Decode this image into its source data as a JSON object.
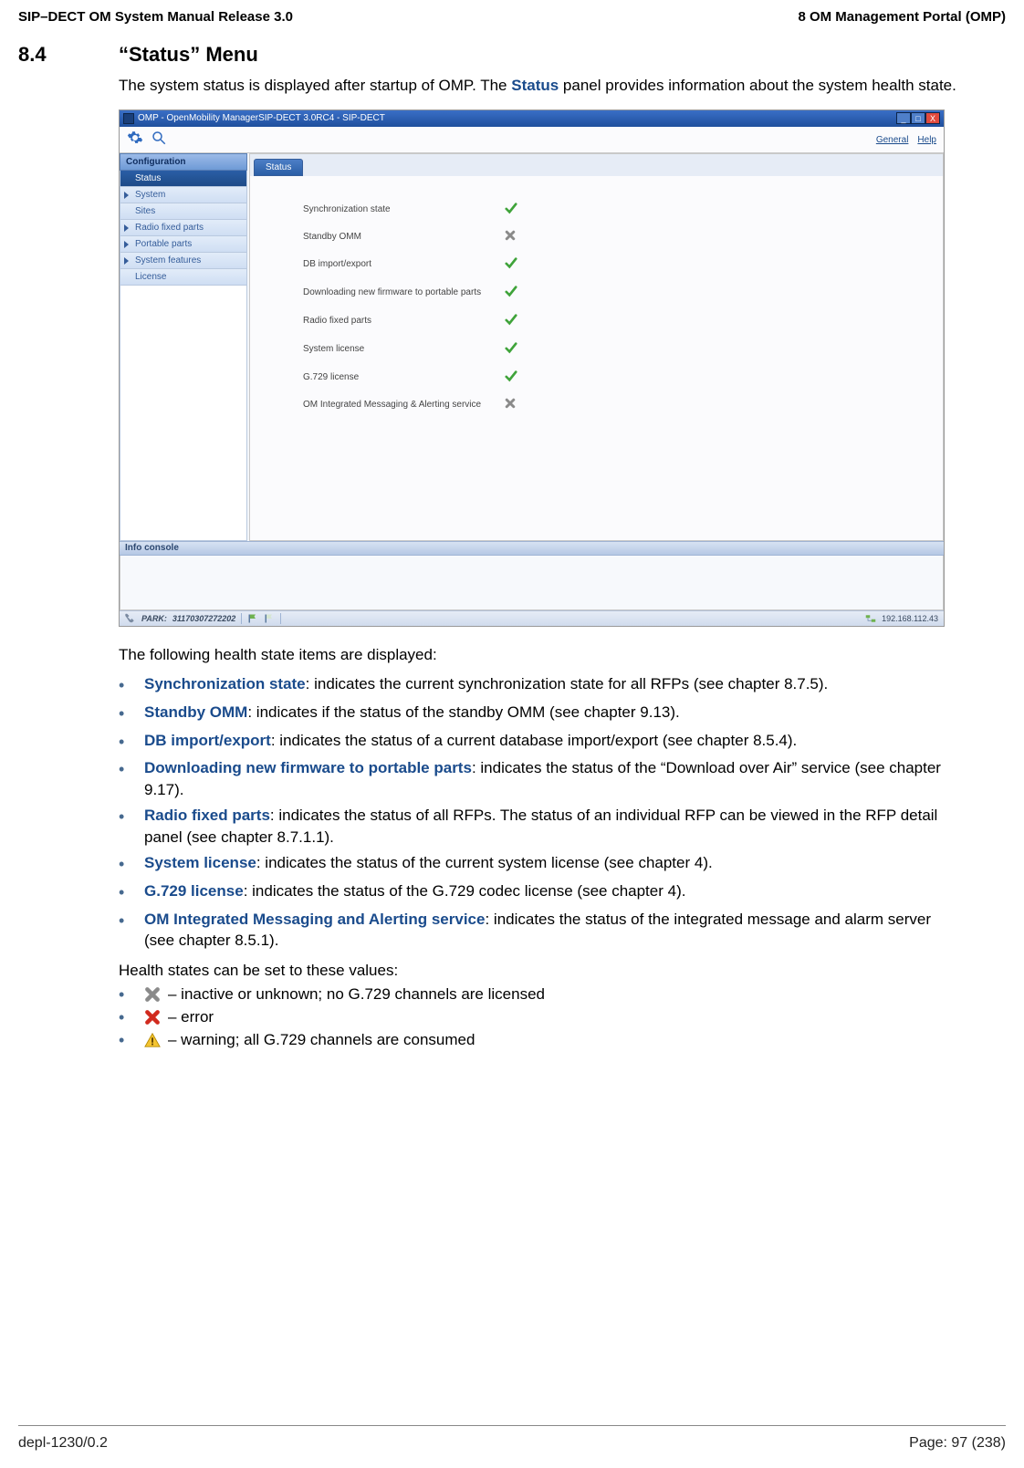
{
  "header": {
    "left": "SIP–DECT OM System Manual Release 3.0",
    "right": "8 OM Management Portal (OMP)"
  },
  "section": {
    "num": "8.4",
    "title": "“Status” Menu"
  },
  "intro": {
    "pre": "The system status is displayed after startup of OMP. The ",
    "bold": "Status",
    "post": " panel provides information about the system health state."
  },
  "app": {
    "title": "OMP - OpenMobility ManagerSIP-DECT 3.0RC4 - SIP-DECT",
    "nav": {
      "general": "General",
      "help": "Help"
    },
    "side_head": "Configuration",
    "sidebar": [
      {
        "label": "Status",
        "selected": true,
        "arrow": false
      },
      {
        "label": "System",
        "selected": false,
        "arrow": true
      },
      {
        "label": "Sites",
        "selected": false,
        "arrow": false
      },
      {
        "label": "Radio fixed parts",
        "selected": false,
        "arrow": true
      },
      {
        "label": "Portable parts",
        "selected": false,
        "arrow": true
      },
      {
        "label": "System features",
        "selected": false,
        "arrow": true
      },
      {
        "label": "License",
        "selected": false,
        "arrow": false
      }
    ],
    "tab": "Status",
    "rows": [
      {
        "label": "Synchronization state",
        "icon": "ok"
      },
      {
        "label": "Standby OMM",
        "icon": "x"
      },
      {
        "label": "DB import/export",
        "icon": "ok"
      },
      {
        "label": "Downloading new firmware to portable parts",
        "icon": "ok"
      },
      {
        "label": "Radio fixed parts",
        "icon": "ok"
      },
      {
        "label": "System license",
        "icon": "ok"
      },
      {
        "label": "G.729 license",
        "icon": "ok"
      },
      {
        "label": "OM Integrated Messaging & Alerting service",
        "icon": "x"
      }
    ],
    "info_console": "Info console",
    "statusbar": {
      "park_label": "PARK:",
      "park_value": "31170307272202",
      "ip": "192.168.112.43"
    }
  },
  "following_line": "The following health state items are displayed:",
  "items": [
    {
      "term": "Synchronization state",
      "rest": ": indicates the current synchronization state for ",
      "bold": "all",
      "rest2": " RFPs (see chapter 8.7.5)."
    },
    {
      "term": "Standby OMM",
      "rest": ": indicates if the status of the standby OMM (see chapter 9.13).",
      "bold": "",
      "rest2": ""
    },
    {
      "term": "DB import/export",
      "rest": ": indicates the status of a current database import/export (see chapter 8.5.4).",
      "bold": "",
      "rest2": ""
    },
    {
      "term": "Downloading new firmware to portable parts",
      "rest": ": indicates the status of the “Download over Air” service (see chapter 9.17).",
      "bold": "",
      "rest2": ""
    },
    {
      "term": "Radio fixed parts",
      "rest": ": indicates the status of ",
      "bold": "all",
      "rest2": " RFPs. The status of an individual RFP can be viewed in the RFP detail panel (see chapter 8.7.1.1)."
    },
    {
      "term": "System license",
      "rest": ": indicates the status of the current system license (see chapter 4).",
      "bold": "",
      "rest2": ""
    },
    {
      "term": "G.729 license",
      "rest": ": indicates the status of the G.729 codec license (see chapter 4).",
      "bold": "",
      "rest2": ""
    },
    {
      "term": "OM Integrated Messaging and Alerting service",
      "rest": ": indicates the status of the integrated message and alarm server (see chapter 8.5.1).",
      "bold": "",
      "rest2": ""
    }
  ],
  "values_intro": "Health states can be set to these values:",
  "values": [
    {
      "icon": "greyx",
      "text": " – inactive or unknown; no G.729 channels are licensed"
    },
    {
      "icon": "redx",
      "text": " – error"
    },
    {
      "icon": "warn",
      "text": " – warning; all G.729 channels are consumed"
    }
  ],
  "footer": {
    "left": "depl-1230/0.2",
    "right": "Page: 97 (238)"
  }
}
